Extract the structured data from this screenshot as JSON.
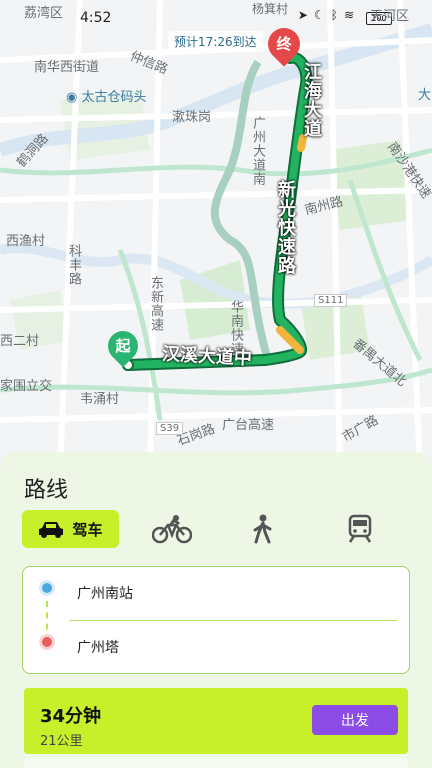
{
  "status_bar": {
    "time": "4:52",
    "icons": [
      "location-arrow-icon",
      "moon-icon",
      "bluetooth-icon",
      "signal-icon",
      "wifi-icon"
    ],
    "battery": "100"
  },
  "map": {
    "eta_text": "预计17:26到达",
    "labels": {
      "liwan": "荔湾区",
      "tianhe": "天河区",
      "yangzhou": "杨箕村",
      "nanhuaxi": "南华西街道",
      "zhongyi": "仲信路",
      "taiguca": "太古仓码头",
      "shuirugang": "漱珠岗",
      "wanhe": "万和",
      "guangzhou_avenue_s": "广州大道南",
      "nanzhou_road": "南州路",
      "nanshagang": "南沙港快速",
      "jiaodong": "鹤洞路",
      "xiyu": "西渔村",
      "kefeng": "科丰路",
      "dongxin": "东新高速",
      "huanan": "华南快速",
      "lixiercun": "西二村",
      "jiadi": "家围立交",
      "weiyong": "韦涌村",
      "shijiao": "石岗路",
      "guangtai": "广台高速",
      "shiguang": "市广路",
      "panyu": "番禺大道北",
      "s111": "S111",
      "s39": "S39",
      "gd": "大"
    },
    "route_labels": {
      "jianghai": "江海大道",
      "xinguang": "新光快速路",
      "hanxi": "汉溪大道中"
    },
    "end_marker": "终",
    "start_marker": "起"
  },
  "panel": {
    "title": "路线",
    "modes": [
      {
        "icon": "car-icon",
        "label": "驾车",
        "active": true
      },
      {
        "icon": "bicycle-icon",
        "label": "",
        "active": false
      },
      {
        "icon": "walk-icon",
        "label": "",
        "active": false
      },
      {
        "icon": "train-icon",
        "label": "",
        "active": false
      }
    ],
    "origin": "广州南站",
    "destination": "广州塔",
    "result": {
      "duration": "34分钟",
      "distance": "21公里",
      "go_label": "出发"
    },
    "colors": {
      "accent": "#c7f02b",
      "go_button": "#8c4de6",
      "route": "#1e9a56"
    }
  }
}
